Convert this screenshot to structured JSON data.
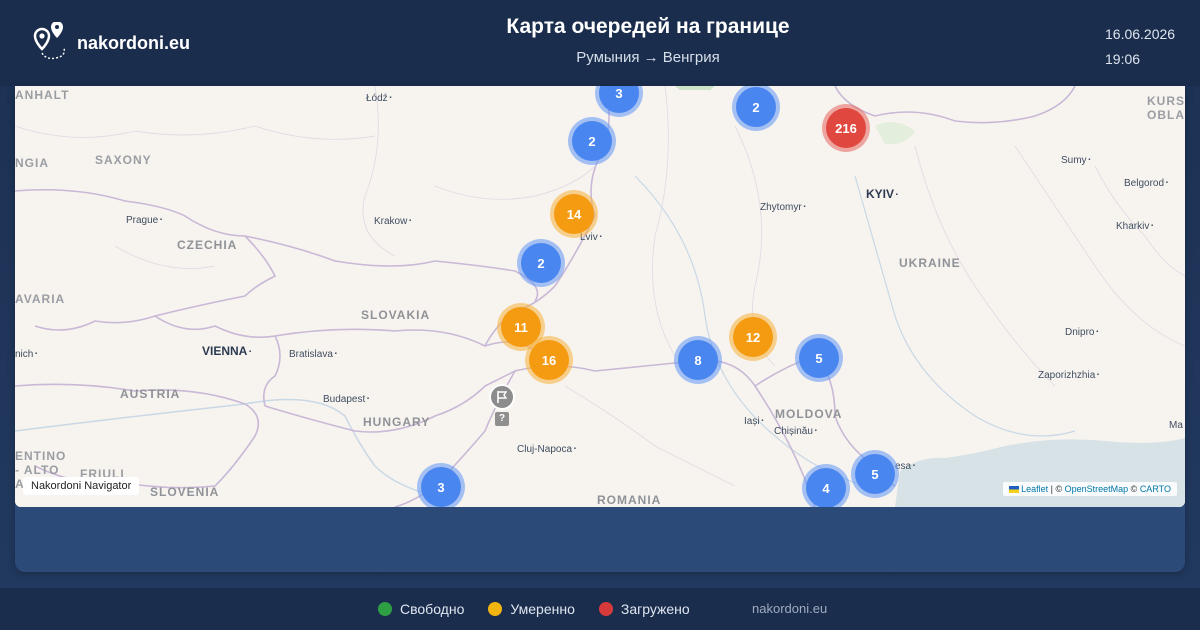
{
  "header": {
    "site_name": "nakordoni.eu",
    "title": "Карта очередей на границе",
    "route": "Румыния → Венгрия",
    "date": "16.06.2026",
    "time": "19:06"
  },
  "map": {
    "labels": {
      "countries": [
        "CZECHIA",
        "SLOVAKIA",
        "AUSTRIA",
        "HUNGARY",
        "SLOVENIA",
        "ROMANIA",
        "UKRAINE",
        "MOLDOVA"
      ],
      "regions": [
        "SAXONY",
        "ANHALT",
        "KURSK OBLAS",
        "AVARIA",
        "NGIA",
        "ENTINO - ALTO ADIGE/",
        "FRIULI GIULIA"
      ],
      "capitals": [
        "VIENNA",
        "KYIV"
      ],
      "cities": [
        "Łódź",
        "Prague",
        "Krakow",
        "Lviv",
        "Zhytomyr",
        "Sumy",
        "Belgorod",
        "Kharkiv",
        "Bratislava",
        "Budapest",
        "Cluj-Napoca",
        "Iași",
        "Chișinău",
        "Dnipro",
        "Zaporizhzhia",
        "Ma",
        "nich",
        "esa"
      ]
    },
    "clusters": [
      {
        "count": "3",
        "level": "blue"
      },
      {
        "count": "2",
        "level": "blue"
      },
      {
        "count": "216",
        "level": "red"
      },
      {
        "count": "2",
        "level": "blue"
      },
      {
        "count": "14",
        "level": "orange"
      },
      {
        "count": "2",
        "level": "blue"
      },
      {
        "count": "11",
        "level": "orange"
      },
      {
        "count": "16",
        "level": "orange"
      },
      {
        "count": "8",
        "level": "blue"
      },
      {
        "count": "12",
        "level": "orange"
      },
      {
        "count": "5",
        "level": "blue"
      },
      {
        "count": "3",
        "level": "blue"
      },
      {
        "count": "4",
        "level": "blue"
      },
      {
        "count": "5",
        "level": "blue"
      }
    ],
    "unknown_marker": "?",
    "nav_label": "Nakordoni Navigator",
    "attribution": {
      "leaflet": "Leaflet",
      "separator": " | © ",
      "osm": "OpenStreetMap",
      "carto_prefix": " © ",
      "carto": "CARTO"
    }
  },
  "legend": {
    "items": [
      {
        "label": "Свободно",
        "color": "#2ea043"
      },
      {
        "label": "Умеренно",
        "color": "#f2b50f"
      },
      {
        "label": "Загружено",
        "color": "#d63a3a"
      }
    ],
    "site": "nakordoni.eu"
  },
  "colors": {
    "cluster_blue": "#4a86ef",
    "cluster_orange": "#f59b12",
    "cluster_red": "#e0473f"
  }
}
